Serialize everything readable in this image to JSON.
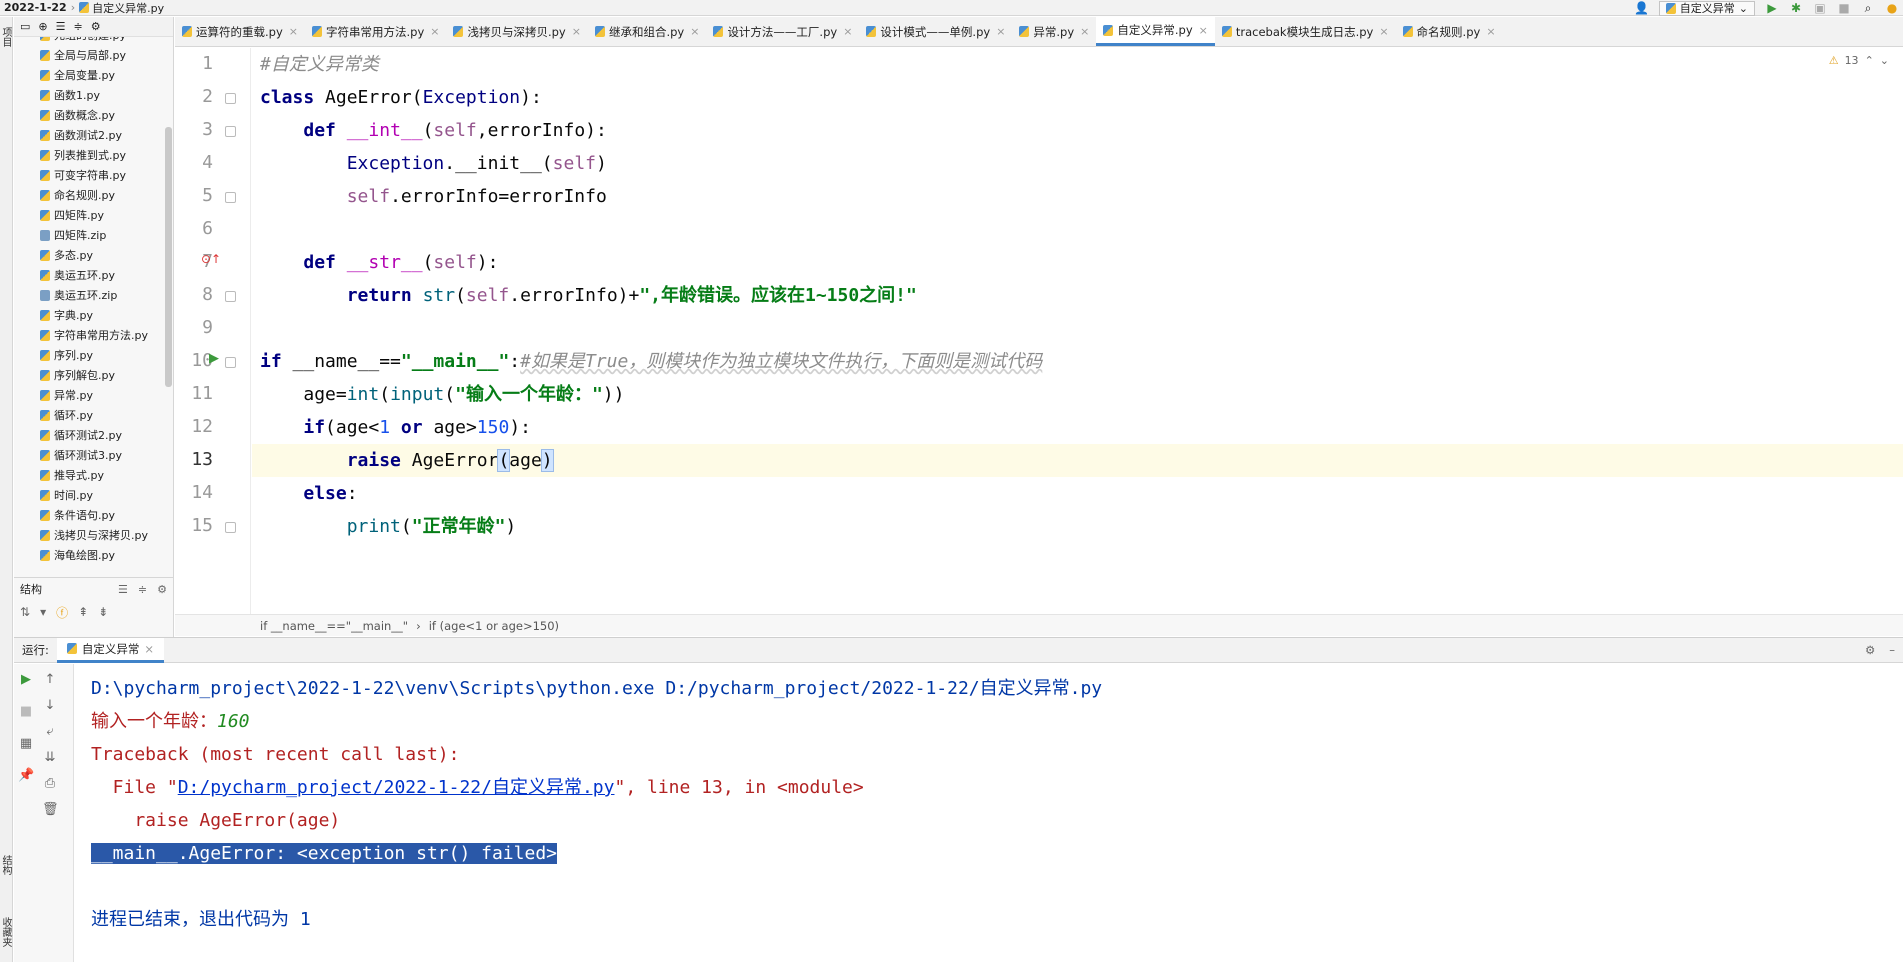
{
  "topbar": {
    "project": "2022-1-22",
    "file": "自定义异常.py",
    "run_config": "自定义异常"
  },
  "left_stripe": {
    "project_label": "项目",
    "structure_label": "结构",
    "favorites_label": "收藏夹"
  },
  "project_files": [
    {
      "name": "元组的创建.py",
      "type": "py"
    },
    {
      "name": "全局与局部.py",
      "type": "py"
    },
    {
      "name": "全局变量.py",
      "type": "py"
    },
    {
      "name": "函数1.py",
      "type": "py"
    },
    {
      "name": "函数概念.py",
      "type": "py"
    },
    {
      "name": "函数测试2.py",
      "type": "py"
    },
    {
      "name": "列表推到式.py",
      "type": "py"
    },
    {
      "name": "可变字符串.py",
      "type": "py"
    },
    {
      "name": "命名规则.py",
      "type": "py"
    },
    {
      "name": "四矩阵.py",
      "type": "py"
    },
    {
      "name": "四矩阵.zip",
      "type": "zip"
    },
    {
      "name": "多态.py",
      "type": "py"
    },
    {
      "name": "奥运五环.py",
      "type": "py"
    },
    {
      "name": "奥运五环.zip",
      "type": "zip"
    },
    {
      "name": "字典.py",
      "type": "py"
    },
    {
      "name": "字符串常用方法.py",
      "type": "py"
    },
    {
      "name": "序列.py",
      "type": "py"
    },
    {
      "name": "序列解包.py",
      "type": "py"
    },
    {
      "name": "异常.py",
      "type": "py"
    },
    {
      "name": "循环.py",
      "type": "py"
    },
    {
      "name": "循环测试2.py",
      "type": "py"
    },
    {
      "name": "循环测试3.py",
      "type": "py"
    },
    {
      "name": "推导式.py",
      "type": "py"
    },
    {
      "name": "时间.py",
      "type": "py"
    },
    {
      "name": "条件语句.py",
      "type": "py"
    },
    {
      "name": "浅拷贝与深拷贝.py",
      "type": "py"
    },
    {
      "name": "海龟绘图.py",
      "type": "py"
    }
  ],
  "structure": {
    "title": "结构"
  },
  "tabs": [
    {
      "label": "运算符的重载.py",
      "active": false
    },
    {
      "label": "字符串常用方法.py",
      "active": false
    },
    {
      "label": "浅拷贝与深拷贝.py",
      "active": false
    },
    {
      "label": "继承和组合.py",
      "active": false
    },
    {
      "label": "设计方法——工厂.py",
      "active": false
    },
    {
      "label": "设计模式——单例.py",
      "active": false
    },
    {
      "label": "异常.py",
      "active": false
    },
    {
      "label": "自定义异常.py",
      "active": true
    },
    {
      "label": "tracebak模块生成日志.py",
      "active": false
    },
    {
      "label": "命名规则.py",
      "active": false
    }
  ],
  "editor": {
    "warning_count": "13",
    "current_line": 13,
    "line_numbers": [
      "1",
      "2",
      "3",
      "4",
      "5",
      "6",
      "7",
      "8",
      "9",
      "10",
      "11",
      "12",
      "13",
      "14",
      "15"
    ],
    "code": {
      "l1_comment": "#自定义异常类",
      "l2_kw": "class ",
      "l2_name": "AgeError",
      "l2_p1": "(",
      "l2_base": "Exception",
      "l2_p2": "):",
      "l3_indent": "    ",
      "l3_kw": "def ",
      "l3_fn": "__int__",
      "l3_p1": "(",
      "l3_self": "self",
      "l3_rest": ",errorInfo):",
      "l4_indent": "        ",
      "l4_base": "Exception",
      "l4_dot": ".",
      "l4_init": "__init__",
      "l4_p1": "(",
      "l4_self": "self",
      "l4_p2": ")",
      "l5_indent": "        ",
      "l5_self": "self",
      "l5_rest": ".errorInfo=errorInfo",
      "l7_indent": "    ",
      "l7_kw": "def ",
      "l7_fn": "__str__",
      "l7_p1": "(",
      "l7_self": "self",
      "l7_p2": "):",
      "l8_indent": "        ",
      "l8_kw": "return ",
      "l8_str": "str",
      "l8_p1": "(",
      "l8_self": "self",
      "l8_rest": ".errorInfo)+",
      "l8_literal": "\",年龄错误。应该在1~150之间!\"",
      "l10_kw": "if ",
      "l10_name": "__name__",
      "l10_eq": "==",
      "l10_str": "\"__main__\"",
      "l10_colon": ":",
      "l10_comment": "#如果是True，则模块作为独立模块文件执行，下面则是测试代码",
      "l11_indent": "    ",
      "l11_a": "age=",
      "l11_int": "int",
      "l11_p1": "(",
      "l11_input": "input",
      "l11_p2": "(",
      "l11_str": "\"输入一个年龄：\"",
      "l11_p3": "))",
      "l12_indent": "    ",
      "l12_kw": "if",
      "l12_a": "(age<",
      "l12_n1": "1",
      "l12_or": " or ",
      "l12_b": "age>",
      "l12_n2": "150",
      "l12_c": "):",
      "l13_indent": "        ",
      "l13_kw": "raise ",
      "l13_name": "AgeError",
      "l13_p1": "(",
      "l13_arg": "age",
      "l13_p2": ")",
      "l14_indent": "    ",
      "l14_kw": "else",
      "l14_colon": ":",
      "l15_indent": "        ",
      "l15_fn": "print",
      "l15_p1": "(",
      "l15_str": "\"正常年龄\"",
      "l15_p2": ")"
    }
  },
  "breadcrumbs": [
    "if __name__==\"__main__\"",
    "if (age<1 or age>150)"
  ],
  "run": {
    "label": "运行:",
    "tab": "自定义异常",
    "console": {
      "cmd": "D:\\pycharm_project\\2022-1-22\\venv\\Scripts\\python.exe D:/pycharm_project/2022-1-22/自定义异常.py",
      "prompt": "输入一个年龄：",
      "input_value": "160",
      "traceback_header": "Traceback (most recent call last):",
      "file_prefix": "  File \"",
      "file_link": "D:/pycharm_project/2022-1-22/自定义异常.py",
      "file_suffix": "\", line 13, in <module>",
      "raise_line": "    raise AgeError(age)",
      "error_line": "__main__.AgeError: <exception str() failed>",
      "exit_msg_prefix": "进程已结束，退出代码为 ",
      "exit_code": "1"
    }
  }
}
